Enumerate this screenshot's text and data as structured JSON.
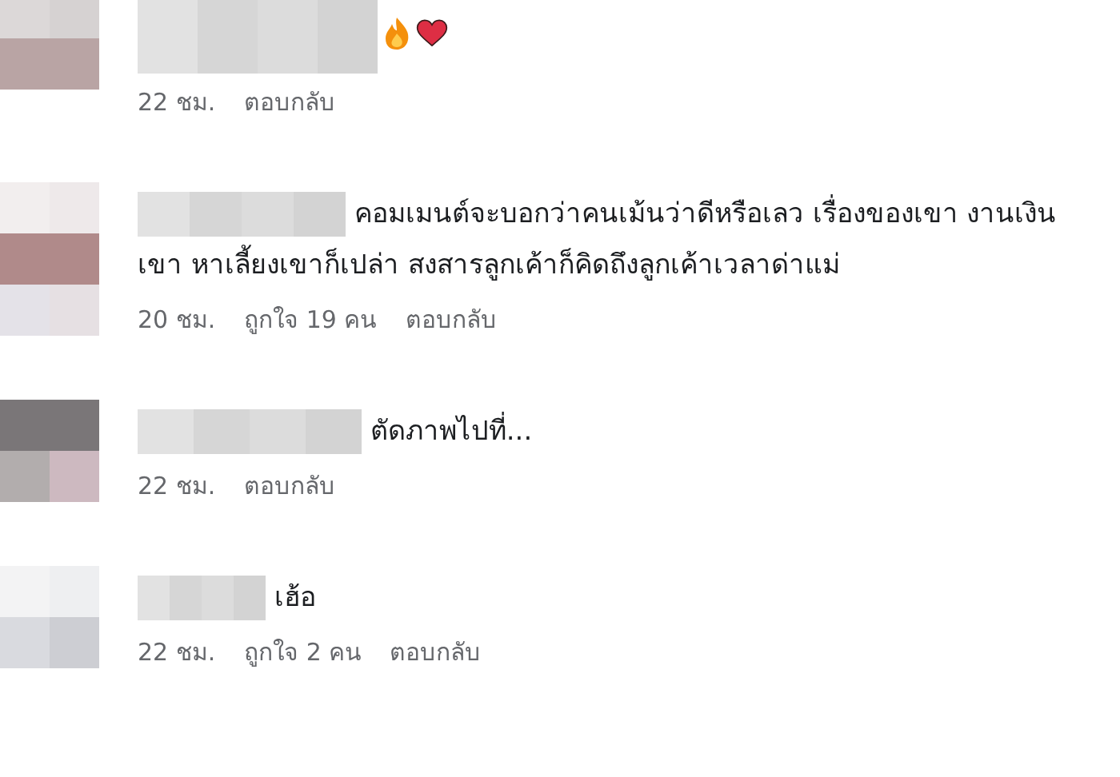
{
  "comments": [
    {
      "kind": "emoji",
      "time": "22 ชม.",
      "reply": "ตอบกลับ"
    },
    {
      "kind": "text",
      "body": "คอมเมนต์จะบอกว่าคนเม้นว่าดีหรือเลว เรื่องของเขา งานเงินเขา หาเลี้ยงเขาก็เปล่า สงสารลูกเค้าก็คิดถึงลูกเค้าเวลาด่าแม่",
      "time": "20 ชม.",
      "likes": "ถูกใจ 19 คน",
      "reply": "ตอบกลับ"
    },
    {
      "kind": "text",
      "body": "ตัดภาพไปที่...",
      "time": "22 ชม.",
      "reply": "ตอบกลับ"
    },
    {
      "kind": "text",
      "body": "เฮ้อ",
      "time": "22 ชม.",
      "likes": "ถูกใจ 2 คน",
      "reply": "ตอบกลับ"
    }
  ]
}
